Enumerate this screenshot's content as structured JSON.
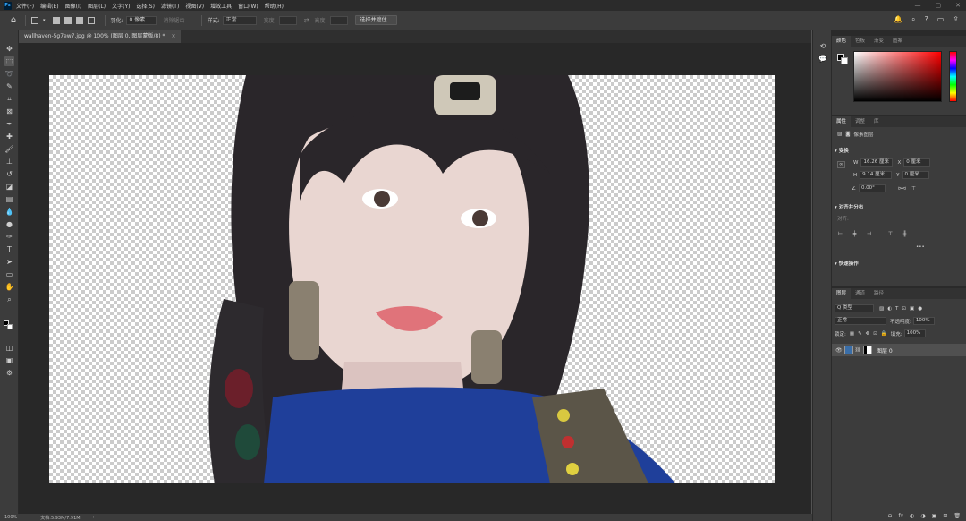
{
  "app": {
    "logo": "Ps"
  },
  "menubar": {
    "items": [
      "文件(F)",
      "编辑(E)",
      "图像(I)",
      "图层(L)",
      "文字(Y)",
      "选择(S)",
      "滤镜(T)",
      "视图(V)",
      "增效工具",
      "窗口(W)",
      "帮助(H)"
    ]
  },
  "window_controls": {
    "minimize": "—",
    "restore": "▢",
    "close": "✕"
  },
  "options_bar": {
    "feather_label": "羽化:",
    "feather_value": "0 像素",
    "antialias_label": "消除锯齿",
    "style_label": "样式:",
    "style_value": "正常",
    "width_label": "宽度:",
    "height_label": "高度:",
    "select_subject_button": "选择并遮住..."
  },
  "document": {
    "tab_title": "wallhaven-5g7ew7.jpg @ 100% (图层 0, 图层蒙版/8) *",
    "close": "×"
  },
  "statusbar": {
    "zoom": "100%",
    "doc_info": "文档:5.93M/7.91M",
    "arrow": "›"
  },
  "color_panel": {
    "tabs": [
      "颜色",
      "色板",
      "渐变",
      "图案"
    ],
    "active_tab": 0
  },
  "properties_panel": {
    "tabs": [
      "属性",
      "调整",
      "库"
    ],
    "layer_type": "像素图层",
    "transform_title": "变换",
    "w_label": "W",
    "w_value": "16.26 厘米",
    "x_label": "X",
    "x_value": "0 厘米",
    "h_label": "H",
    "h_value": "9.14 厘米",
    "y_label": "Y",
    "y_value": "0 厘米",
    "angle_value": "0.00°",
    "align_title": "对齐并分布",
    "align_sub": "对齐:",
    "more": "•••",
    "quick_actions_title": "快速操作"
  },
  "layers_panel": {
    "tabs": [
      "图层",
      "通道",
      "路径"
    ],
    "filter_value": "Q 类型",
    "blend_mode": "正常",
    "opacity_label": "不透明度:",
    "opacity_value": "100%",
    "lock_label": "锁定:",
    "fill_label": "填充:",
    "fill_value": "100%",
    "layer_name": "图层 0",
    "bottom_icons": [
      "⊖",
      "fx",
      "◐",
      "◑",
      "▣",
      "⊞",
      "🗑"
    ]
  }
}
